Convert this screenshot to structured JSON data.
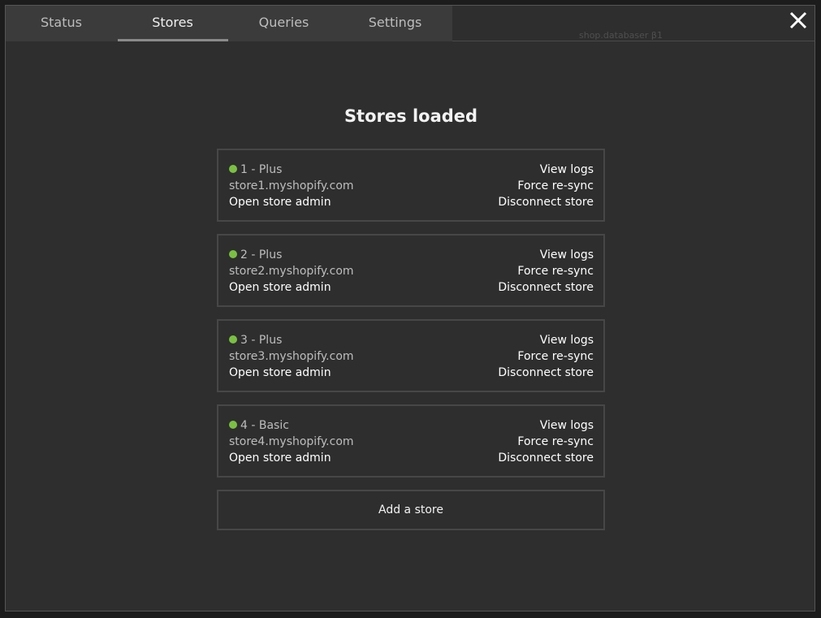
{
  "tabs": [
    {
      "label": "Status"
    },
    {
      "label": "Stores",
      "active": true
    },
    {
      "label": "Queries"
    },
    {
      "label": "Settings"
    }
  ],
  "background_text": "shop.databaser β1",
  "close_icon": "close-icon",
  "title": "Stores loaded",
  "status_color": "#7ac142",
  "stores": [
    {
      "plan": "1 - Plus",
      "domain": "store1.myshopify.com",
      "open_admin": "Open store admin",
      "view_logs": "View logs",
      "force_resync": "Force re-sync",
      "disconnect": "Disconnect store"
    },
    {
      "plan": "2 - Plus",
      "domain": "store2.myshopify.com",
      "open_admin": "Open store admin",
      "view_logs": "View logs",
      "force_resync": "Force re-sync",
      "disconnect": "Disconnect store"
    },
    {
      "plan": "3 - Plus",
      "domain": "store3.myshopify.com",
      "open_admin": "Open store admin",
      "view_logs": "View logs",
      "force_resync": "Force re-sync",
      "disconnect": "Disconnect store"
    },
    {
      "plan": "4 - Basic",
      "domain": "store4.myshopify.com",
      "open_admin": "Open store admin",
      "view_logs": "View logs",
      "force_resync": "Force re-sync",
      "disconnect": "Disconnect store"
    }
  ],
  "add_store_label": "Add a store"
}
